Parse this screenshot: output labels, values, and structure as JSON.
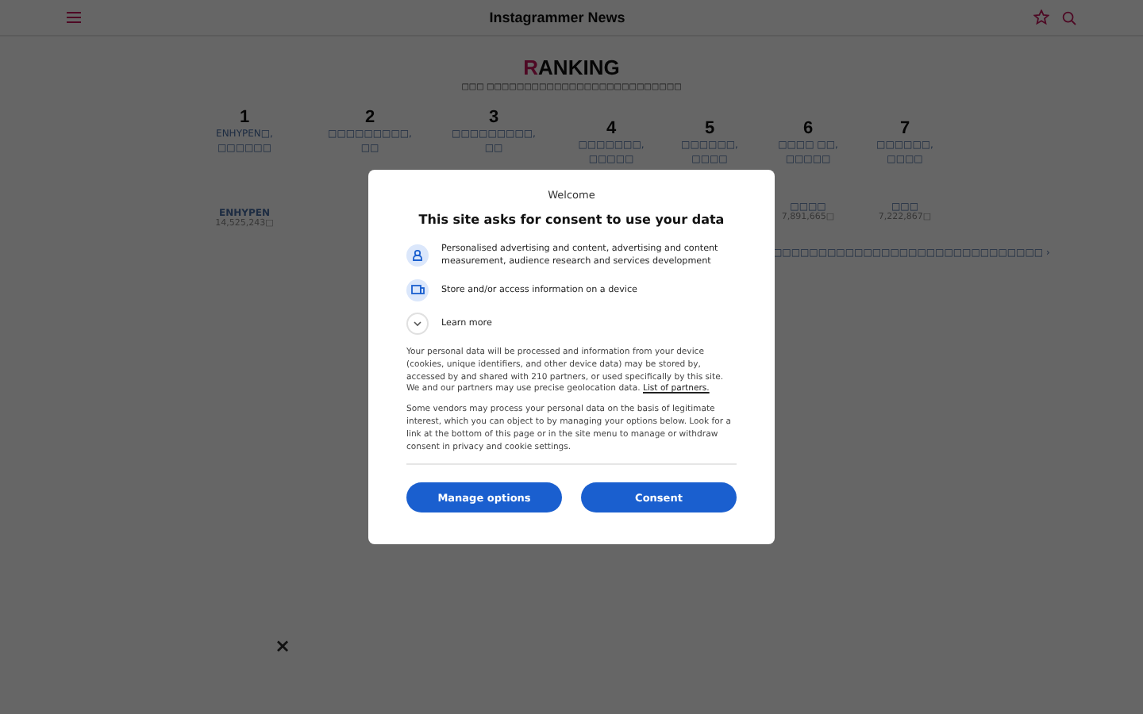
{
  "header": {
    "title": "Instagrammer News"
  },
  "ranking": {
    "title_initial": "R",
    "title_rest": "ANKING",
    "subtitle": "□□□ □□□□□□□□□□□□□□□□□□□□□□□□□□",
    "items": [
      {
        "rank": "1",
        "alt": "ENHYPEN□, □□□□□□",
        "name": "ENHYPEN",
        "count": "14,525,243□"
      },
      {
        "rank": "2",
        "alt": "□□□□□□□□□, □□"
      },
      {
        "rank": "3",
        "alt": "□□□□□□□□□, □□"
      },
      {
        "rank": "4",
        "alt": "□□□□□□□, □□□□□"
      },
      {
        "rank": "5",
        "alt": "□□□□□□, □□□□"
      },
      {
        "rank": "6",
        "alt": "□□□□ □□, □□□□□",
        "name": "□□□□",
        "count": "7,891,665□"
      },
      {
        "rank": "7",
        "alt": "□□□□□□, □□□□",
        "name": "□□□",
        "count": "7,222,867□"
      }
    ],
    "more_link": "□□□□□□□□□□□□□□□□□□□□□□□□□□□□□□ ›"
  },
  "consent": {
    "welcome": "Welcome",
    "title": "This site asks for consent to use your data",
    "purposes": [
      {
        "kind": "person",
        "text": "Personalised advertising and content, advertising and content measurement, audience research and services development"
      },
      {
        "kind": "device",
        "text": "Store and/or access information on a device"
      }
    ],
    "learn_more": "Learn more",
    "expanded": false,
    "paragraph_1": "Your personal data will be processed and information from your device (cookies, unique identifiers, and other device data) may be stored by, accessed by and shared with 210 partners, or used specifically by this site. We and our partners may use precise geolocation data.",
    "partners_link": "List of partners.",
    "paragraph_2": "Some vendors may process your personal data on the basis of legitimate interest, which you can object to by managing your options below. Look for a link at the bottom of this page or in the site menu to manage or withdraw consent in privacy and cookie settings.",
    "buttons": [
      "Manage options",
      "Consent"
    ]
  },
  "close": "×"
}
